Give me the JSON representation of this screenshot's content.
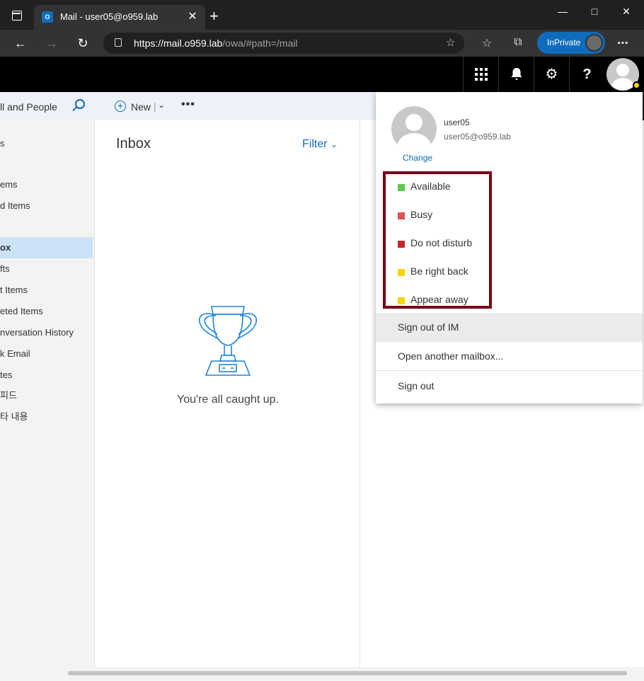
{
  "browser": {
    "tab_title": "Mail - user05@o959.lab",
    "tab_favicon": "O",
    "url_host": "https://mail.o959.lab",
    "url_path": "/owa/#path=/mail",
    "inprivate_label": "InPrivate",
    "new_tab": "+",
    "close_tab": "✕"
  },
  "search": {
    "placeholder_visible": "ll and People"
  },
  "folders": [
    {
      "label": "s",
      "selected": false
    },
    {
      "label": "ems",
      "selected": false
    },
    {
      "label": "d Items",
      "selected": false
    },
    {
      "label": "ox",
      "selected": true
    },
    {
      "label": "fts",
      "selected": false
    },
    {
      "label": "t Items",
      "selected": false
    },
    {
      "label": "eted Items",
      "selected": false
    },
    {
      "label": "nversation History",
      "selected": false
    },
    {
      "label": "k Email",
      "selected": false
    },
    {
      "label": "tes",
      "selected": false
    },
    {
      "label": " 피드",
      "selected": false
    },
    {
      "label": "타 내용",
      "selected": false
    }
  ],
  "commands": {
    "new_label": "New",
    "more": "•••"
  },
  "message_list": {
    "title": "Inbox",
    "filter_label": "Filter",
    "empty_text": "You're all caught up."
  },
  "header_icons": {
    "help": "?"
  },
  "user_flyout": {
    "name": "user05",
    "email": "user05@o959.lab",
    "change_label": "Change",
    "statuses": [
      {
        "label": "Available",
        "color": "#5cc94f"
      },
      {
        "label": "Busy",
        "color": "#d13438"
      },
      {
        "label": "Do not disturb",
        "color": "#c4262e"
      },
      {
        "label": "Be right back",
        "color": "#ffd200"
      },
      {
        "label": "Appear away",
        "color": "#ffd200"
      }
    ],
    "menu": {
      "sign_out_im": "Sign out of IM",
      "open_mailbox": "Open another mailbox...",
      "sign_out": "Sign out"
    }
  }
}
